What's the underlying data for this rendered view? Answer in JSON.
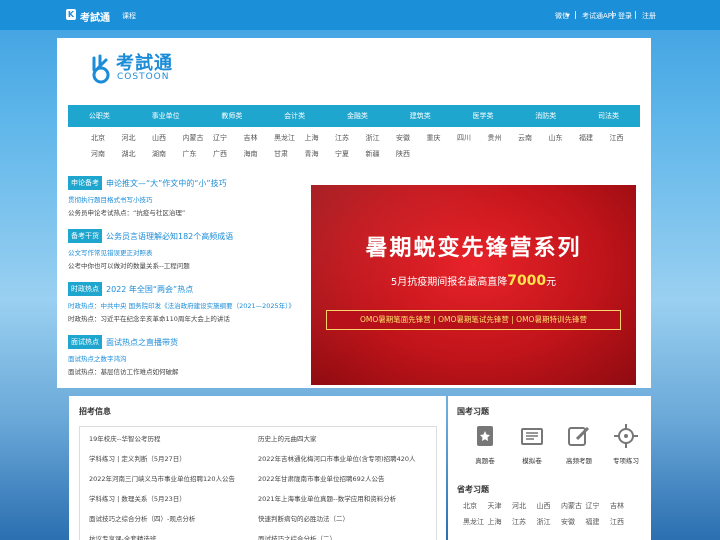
{
  "topbar": {
    "logo_glyph": "K",
    "brand": "考試通",
    "course": "课程",
    "wechat": "微信",
    "app": "考试通APP",
    "login": "登录",
    "register": "注册"
  },
  "header": {
    "logo_cn": "考試通",
    "logo_en": "COSTOON",
    "categories": [
      "公职类",
      "事业单位",
      "教师类",
      "会计类",
      "金融类",
      "建筑类",
      "医学类",
      "消防类",
      "司法类"
    ],
    "regions_row1": [
      "北京",
      "河北",
      "山西",
      "内蒙古",
      "辽宁",
      "吉林",
      "黑龙江",
      "上海",
      "江苏",
      "浙江",
      "安徽",
      "重庆",
      "四川",
      "贵州",
      "云南",
      "山东",
      "福建",
      "江西"
    ],
    "regions_row2": [
      "河南",
      "湖北",
      "湖南",
      "广东",
      "广西",
      "海南",
      "甘肃",
      "青海",
      "宁夏",
      "新疆",
      "陕西"
    ]
  },
  "news": [
    {
      "tag": "申论备考",
      "title": "申论推文—“大”作文中的“小”技巧",
      "sub": "贯彻执行题目格式书写小技巧",
      "line": "公务员申论考试热点：“抗疫与社区治理”"
    },
    {
      "tag": "备考干货",
      "title": "公务员言语理解必知182个高频成语",
      "sub": "公文写作常见错误更正对照表",
      "line": "公考中你也可以做对的数量关系--工程问题"
    },
    {
      "tag": "时政热点",
      "title": "2022 年全国“两会”热点",
      "sub": "时政热点：中共中央  国务院印发《法治政府建设实施纲要（2021—2025年）》",
      "line": "时政热点：习近平在纪念辛亥革命110周年大会上的讲话"
    },
    {
      "tag": "面试热点",
      "title": "面试热点之直播带货",
      "sub": "面试热点之数字鸿沟",
      "line": "面试热点：基层信访工作难点如何破解"
    }
  ],
  "banner": {
    "title": "暑期蜕变先锋营系列",
    "sub_prefix": "5月抗疫期间报名最高直降",
    "price": "7000",
    "sub_suffix": "元",
    "bar": "OMO暑期笔面先锋营 | OMO暑期笔试先锋营 | OMO暑期特训先锋营"
  },
  "recruit": {
    "title": "招考信息",
    "left": [
      "19年校庆--华智公考历程",
      "学科练习 | 定义判断（5月27日）",
      "2022年河南三门峡义马市事业单位招聘120人公告",
      "学科练习 | 数理关系（5月23日）",
      "面试技巧之综合分析（四）-观点分析",
      "抗议专享课-全套精选班"
    ],
    "right": [
      "历史上的元曲四大家",
      "2022年吉林通化梅河口市事业单位(含专项)招聘420人",
      "2022年甘肃陇南市事业单位招聘692人公告",
      "2021年上海事业单位真题--数学应用和资料分析",
      "快速判断病句的必胜功法（二）",
      "面试技巧之综合分析（二）"
    ]
  },
  "exam": {
    "title": "国考习题",
    "items": [
      {
        "label": "真题卷",
        "icon": "star-doc-icon"
      },
      {
        "label": "模拟卷",
        "icon": "paper-icon"
      },
      {
        "label": "高频考题",
        "icon": "edit-icon"
      },
      {
        "label": "专项练习",
        "icon": "target-icon"
      }
    ]
  },
  "prov": {
    "title": "省考习题",
    "row1": [
      "北京",
      "天津",
      "河北",
      "山西",
      "内蒙古",
      "辽宁",
      "吉林"
    ],
    "row2": [
      "黑龙江",
      "上海",
      "江苏",
      "浙江",
      "安徽",
      "福建",
      "江西"
    ]
  }
}
